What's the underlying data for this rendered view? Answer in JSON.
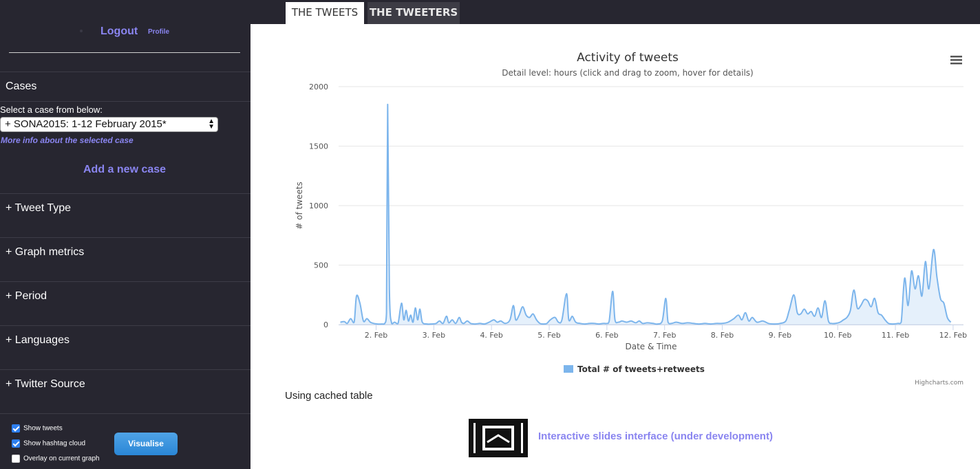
{
  "header": {
    "title": "",
    "tabs": [
      {
        "label": "THE TWEETS",
        "active": true
      },
      {
        "label": "THE TWEETERS",
        "active": false
      }
    ]
  },
  "sidebar": {
    "logout_label": "Logout",
    "profile_label": "Profile",
    "cases_title": "Cases",
    "select_label": "Select a case from below:",
    "selected_case": "+ SONA2015: 1-12 February 2015*",
    "more_info_link": "More info about the selected case",
    "add_case_label": "Add a new case",
    "sections": [
      "+ Tweet Type",
      "+ Graph metrics",
      "+ Period",
      "+ Languages",
      "+ Twitter Source"
    ],
    "options": [
      {
        "label": "Show tweets",
        "checked": true
      },
      {
        "label": "Show hashtag cloud",
        "checked": true
      },
      {
        "label": "Overlay on current graph",
        "checked": false
      }
    ],
    "visualise_label": "Visualise"
  },
  "main": {
    "cached_text": "Using cached table",
    "slides_link": "Interactive slides interface (under development)"
  },
  "colors": {
    "sidebar_bg": "#272630",
    "accent": "#8a85f0",
    "series": "#7cb5ec"
  },
  "icons": {
    "menu": "hamburger-menu-icon",
    "slides": "slides-icon"
  },
  "chart_data": {
    "type": "area",
    "title": "Activity of tweets",
    "subtitle": "Detail level: hours (click and drag to zoom, hover for details)",
    "xlabel": "Date & Time",
    "ylabel": "# of tweets",
    "ylim": [
      0,
      2000
    ],
    "yticks": [
      0,
      500,
      1000,
      1500,
      2000
    ],
    "xticks": [
      "2. Feb",
      "3. Feb",
      "4. Feb",
      "5. Feb",
      "6. Feb",
      "7. Feb",
      "8. Feb",
      "9. Feb",
      "10. Feb",
      "11. Feb",
      "12. Feb"
    ],
    "xlim_days": [
      1.35,
      12.18
    ],
    "legend": {
      "position": "bottom-center"
    },
    "credits": "Highcharts.com",
    "grid": true,
    "series": [
      {
        "name": "Total # of tweets+retweets",
        "points": [
          [
            1.38,
            20
          ],
          [
            1.45,
            25
          ],
          [
            1.5,
            10
          ],
          [
            1.56,
            50
          ],
          [
            1.62,
            20
          ],
          [
            1.66,
            240
          ],
          [
            1.72,
            180
          ],
          [
            1.78,
            30
          ],
          [
            1.84,
            50
          ],
          [
            1.9,
            20
          ],
          [
            1.96,
            10
          ],
          [
            2.02,
            5
          ],
          [
            2.1,
            5
          ],
          [
            2.15,
            10
          ],
          [
            2.18,
            100
          ],
          [
            2.2,
            1850
          ],
          [
            2.23,
            300
          ],
          [
            2.27,
            10
          ],
          [
            2.32,
            20
          ],
          [
            2.38,
            10
          ],
          [
            2.44,
            180
          ],
          [
            2.48,
            40
          ],
          [
            2.52,
            120
          ],
          [
            2.56,
            30
          ],
          [
            2.6,
            80
          ],
          [
            2.64,
            20
          ],
          [
            2.68,
            140
          ],
          [
            2.72,
            40
          ],
          [
            2.76,
            130
          ],
          [
            2.8,
            20
          ],
          [
            2.88,
            5
          ],
          [
            2.96,
            5
          ],
          [
            3.04,
            10
          ],
          [
            3.1,
            30
          ],
          [
            3.16,
            10
          ],
          [
            3.22,
            70
          ],
          [
            3.26,
            15
          ],
          [
            3.32,
            40
          ],
          [
            3.38,
            10
          ],
          [
            3.44,
            60
          ],
          [
            3.48,
            20
          ],
          [
            3.52,
            10
          ],
          [
            3.58,
            30
          ],
          [
            3.64,
            10
          ],
          [
            3.72,
            5
          ],
          [
            3.8,
            10
          ],
          [
            3.88,
            5
          ],
          [
            3.96,
            20
          ],
          [
            4.04,
            40
          ],
          [
            4.1,
            20
          ],
          [
            4.16,
            30
          ],
          [
            4.24,
            10
          ],
          [
            4.32,
            40
          ],
          [
            4.38,
            160
          ],
          [
            4.42,
            40
          ],
          [
            4.48,
            80
          ],
          [
            4.54,
            150
          ],
          [
            4.6,
            80
          ],
          [
            4.66,
            60
          ],
          [
            4.72,
            90
          ],
          [
            4.78,
            40
          ],
          [
            4.84,
            10
          ],
          [
            4.9,
            5
          ],
          [
            4.96,
            10
          ],
          [
            5.02,
            40
          ],
          [
            5.1,
            60
          ],
          [
            5.16,
            20
          ],
          [
            5.22,
            40
          ],
          [
            5.3,
            260
          ],
          [
            5.34,
            40
          ],
          [
            5.4,
            70
          ],
          [
            5.46,
            20
          ],
          [
            5.54,
            10
          ],
          [
            5.62,
            5
          ],
          [
            5.7,
            10
          ],
          [
            5.78,
            10
          ],
          [
            5.86,
            5
          ],
          [
            5.94,
            10
          ],
          [
            6.0,
            10
          ],
          [
            6.04,
            30
          ],
          [
            6.1,
            280
          ],
          [
            6.14,
            40
          ],
          [
            6.2,
            20
          ],
          [
            6.26,
            30
          ],
          [
            6.34,
            20
          ],
          [
            6.42,
            30
          ],
          [
            6.5,
            15
          ],
          [
            6.56,
            30
          ],
          [
            6.62,
            10
          ],
          [
            6.7,
            15
          ],
          [
            6.8,
            10
          ],
          [
            6.88,
            5
          ],
          [
            6.96,
            30
          ],
          [
            7.02,
            220
          ],
          [
            7.06,
            20
          ],
          [
            7.12,
            10
          ],
          [
            7.2,
            20
          ],
          [
            7.3,
            10
          ],
          [
            7.4,
            15
          ],
          [
            7.5,
            10
          ],
          [
            7.6,
            5
          ],
          [
            7.7,
            10
          ],
          [
            7.8,
            5
          ],
          [
            7.9,
            10
          ],
          [
            8.0,
            10
          ],
          [
            8.1,
            20
          ],
          [
            8.2,
            50
          ],
          [
            8.28,
            80
          ],
          [
            8.34,
            40
          ],
          [
            8.4,
            100
          ],
          [
            8.46,
            30
          ],
          [
            8.52,
            60
          ],
          [
            8.6,
            20
          ],
          [
            8.7,
            30
          ],
          [
            8.8,
            10
          ],
          [
            8.9,
            5
          ],
          [
            9.0,
            10
          ],
          [
            9.1,
            30
          ],
          [
            9.16,
            120
          ],
          [
            9.24,
            250
          ],
          [
            9.3,
            100
          ],
          [
            9.36,
            90
          ],
          [
            9.42,
            130
          ],
          [
            9.48,
            90
          ],
          [
            9.54,
            110
          ],
          [
            9.6,
            70
          ],
          [
            9.66,
            140
          ],
          [
            9.72,
            60
          ],
          [
            9.78,
            200
          ],
          [
            9.84,
            30
          ],
          [
            9.9,
            10
          ],
          [
            9.96,
            10
          ],
          [
            10.04,
            20
          ],
          [
            10.1,
            40
          ],
          [
            10.16,
            60
          ],
          [
            10.22,
            120
          ],
          [
            10.28,
            290
          ],
          [
            10.34,
            140
          ],
          [
            10.4,
            160
          ],
          [
            10.46,
            210
          ],
          [
            10.52,
            200
          ],
          [
            10.58,
            150
          ],
          [
            10.64,
            220
          ],
          [
            10.7,
            100
          ],
          [
            10.76,
            80
          ],
          [
            10.82,
            40
          ],
          [
            10.88,
            10
          ],
          [
            10.96,
            5
          ],
          [
            11.04,
            10
          ],
          [
            11.1,
            20
          ],
          [
            11.16,
            390
          ],
          [
            11.22,
            160
          ],
          [
            11.28,
            450
          ],
          [
            11.34,
            300
          ],
          [
            11.4,
            410
          ],
          [
            11.46,
            240
          ],
          [
            11.52,
            530
          ],
          [
            11.58,
            300
          ],
          [
            11.66,
            630
          ],
          [
            11.72,
            400
          ],
          [
            11.78,
            220
          ],
          [
            11.84,
            180
          ],
          [
            11.9,
            60
          ],
          [
            11.96,
            20
          ]
        ]
      }
    ]
  }
}
